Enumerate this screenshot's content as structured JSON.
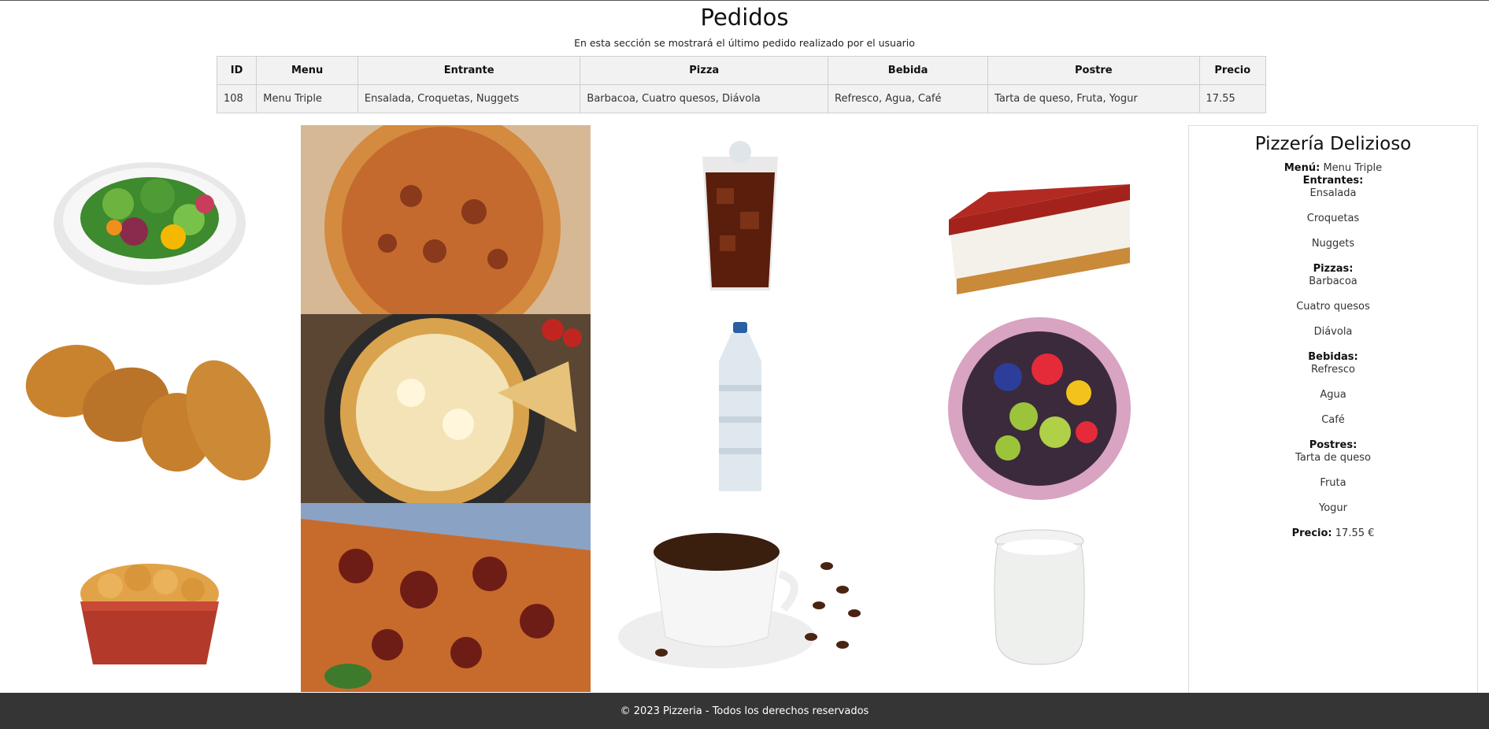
{
  "header": {
    "title": "Pedidos",
    "subtitle": "En esta sección se mostrará el último pedido realizado por el usuario"
  },
  "orders_table": {
    "columns": [
      "ID",
      "Menu",
      "Entrante",
      "Pizza",
      "Bebida",
      "Postre",
      "Precio"
    ],
    "rows": [
      [
        "108",
        "Menu Triple",
        "Ensalada, Croquetas, Nuggets",
        "Barbacoa, Cuatro quesos, Diávola",
        "Refresco, Agua, Café",
        "Tarta de queso, Fruta, Yogur",
        "17.55"
      ]
    ]
  },
  "gallery": {
    "images": [
      "salad-image",
      "bbq-pizza-image",
      "cola-glass-image",
      "cheesecake-image",
      "croquettes-image",
      "four-cheese-pizza-image",
      "water-bottle-image",
      "fruit-bowl-image",
      "nuggets-image",
      "diavola-pizza-image",
      "coffee-cup-image",
      "yogurt-jar-image"
    ]
  },
  "summary": {
    "title": "Pizzería Delizioso",
    "menu_label": "Menú:",
    "menu_value": "Menu Triple",
    "entrantes_label": "Entrantes:",
    "entrantes": [
      "Ensalada",
      "Croquetas",
      "Nuggets"
    ],
    "pizzas_label": "Pizzas:",
    "pizzas": [
      "Barbacoa",
      "Cuatro quesos",
      "Diávola"
    ],
    "bebidas_label": "Bebidas:",
    "bebidas": [
      "Refresco",
      "Agua",
      "Café"
    ],
    "postres_label": "Postres:",
    "postres": [
      "Tarta de queso",
      "Fruta",
      "Yogur"
    ],
    "precio_label": "Precio:",
    "precio_value": "17.55 €"
  },
  "footer": {
    "text": "© 2023 Pizzeria - Todos los derechos reservados"
  },
  "colors": {
    "footer_bg": "#353535",
    "table_bg": "#f2f2f2"
  }
}
